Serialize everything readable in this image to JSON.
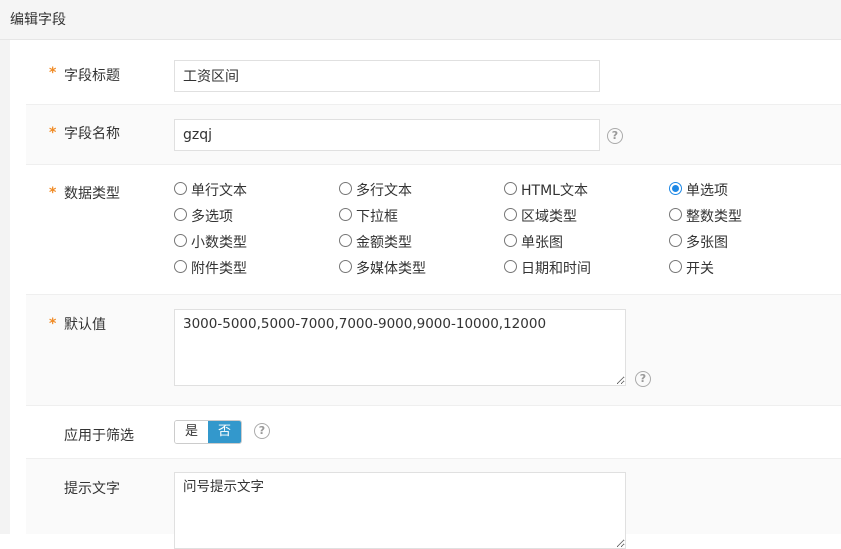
{
  "header": {
    "title": "编辑字段"
  },
  "fields": {
    "title": {
      "label": "字段标题",
      "value": "工资区间",
      "required": "*"
    },
    "name": {
      "label": "字段名称",
      "value": "gzqj",
      "required": "*"
    },
    "type": {
      "label": "数据类型",
      "required": "*",
      "options": [
        "单行文本",
        "多行文本",
        "HTML文本",
        "单选项",
        "多选项",
        "下拉框",
        "区域类型",
        "整数类型",
        "小数类型",
        "金额类型",
        "单张图",
        "多张图",
        "附件类型",
        "多媒体类型",
        "日期和时间",
        "开关"
      ],
      "selected": "单选项"
    },
    "default": {
      "label": "默认值",
      "required": "*",
      "value": "3000-5000,5000-7000,7000-9000,9000-10000,12000"
    },
    "filter": {
      "label": "应用于筛选",
      "yes": "是",
      "no": "否",
      "selected": "否"
    },
    "hint": {
      "label": "提示文字",
      "value": "问号提示文字"
    }
  },
  "icons": {
    "help": "question-circle-icon",
    "help_glyph": "?"
  },
  "colors": {
    "required": "#f08a24",
    "accent": "#1e88e5",
    "toggle_active": "#3398cc"
  }
}
